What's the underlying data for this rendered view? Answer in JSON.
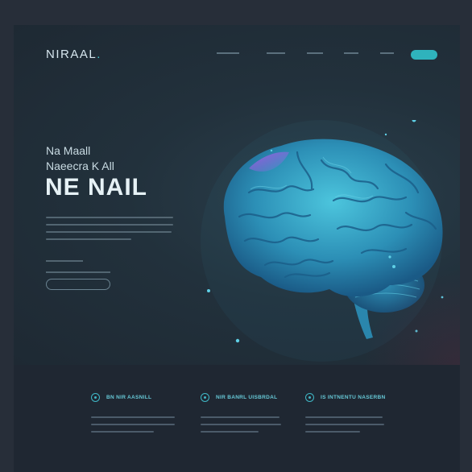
{
  "header": {
    "logo_text": "NIRAAL",
    "logo_dot": ".",
    "nav": [
      {
        "label": ""
      },
      {
        "label": ""
      },
      {
        "label": ""
      },
      {
        "label": ""
      },
      {
        "label": ""
      }
    ],
    "cta_label": ""
  },
  "hero": {
    "line1": "Na Maall",
    "line2": "Naeecra K  All",
    "title": "NE NAIL",
    "button_label": ""
  },
  "features": [
    {
      "title": "BN  NIR  AASNILL",
      "icon": "circle-icon"
    },
    {
      "title": "NIR  BANRL UISBRDAL",
      "icon": "circle-icon"
    },
    {
      "title": "IS  INTNENTU  NASERBN",
      "icon": "circle-icon"
    }
  ],
  "colors": {
    "accent": "#2fb3bc",
    "background": "#272e39",
    "brain": "#3aa6c6"
  }
}
